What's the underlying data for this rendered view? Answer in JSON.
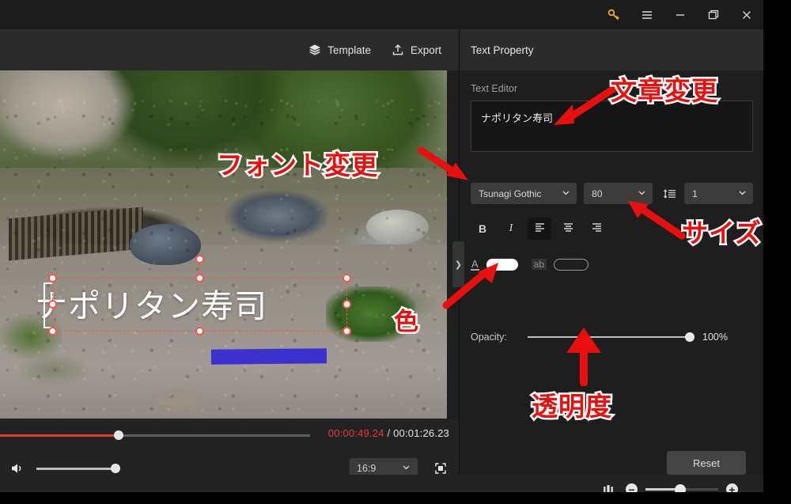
{
  "titlebar": {
    "buttons": [
      {
        "name": "license-key",
        "icon": "key-icon"
      },
      {
        "name": "menu",
        "icon": "hamburger-menu-icon"
      },
      {
        "name": "minimize",
        "icon": "minimize-icon"
      },
      {
        "name": "maximize",
        "icon": "maximize-icon"
      },
      {
        "name": "close",
        "icon": "close-icon"
      }
    ]
  },
  "toolbar": {
    "template_label": "Template",
    "template_icon": "layers-icon",
    "export_label": "Export",
    "export_icon": "upload-icon"
  },
  "preview": {
    "overlay_text": "ナポリタン寿司",
    "selection": {
      "handles": 8,
      "handle_color": "#f2584a",
      "style": "dashed"
    },
    "blue_bar_color": "#3b31cf"
  },
  "transport": {
    "current_time": "00:00:49.24",
    "separator": "/",
    "total_time": "00:01:26.23",
    "progress_percent": 38,
    "volume_percent": 100,
    "volume_icon": "speaker-icon",
    "aspect_ratio": "16:9",
    "aspect_chevron": "chevron-down-icon",
    "fullscreen_icon": "fullscreen-icon"
  },
  "panel": {
    "title": "Text Property",
    "collapse_icon": "chevron-right-icon",
    "section_label": "Text Editor",
    "editor_value": "ナポリタン寿司",
    "font_family": "Tsunagi Gothic",
    "font_size": "80",
    "line_height": "1",
    "line_height_icon": "line-spacing-icon",
    "format": {
      "bold": "B",
      "italic": "I",
      "align_left_icon": "align-left-icon",
      "align_center_icon": "align-center-icon",
      "align_right_icon": "align-right-icon",
      "active_align": "left"
    },
    "color": {
      "text_color_icon": "text-color-A-icon",
      "fill_swatch": "#ffffff",
      "stroke_icon": "text-outline-ab-icon",
      "stroke_swatch": "transparent"
    },
    "opacity_label": "Opacity:",
    "opacity_value": "100%",
    "opacity_percent": 100,
    "reset_label": "Reset"
  },
  "bottombar": {
    "fit_icon": "fit-timeline-icon",
    "zoom_out_icon": "minus-icon",
    "zoom_in_icon": "plus-icon",
    "zoom_percent": 48
  },
  "annotations": {
    "font_change": "フォント変更",
    "text_change": "文章変更",
    "size": "サイズ",
    "color": "色",
    "opacity": "透明度"
  }
}
